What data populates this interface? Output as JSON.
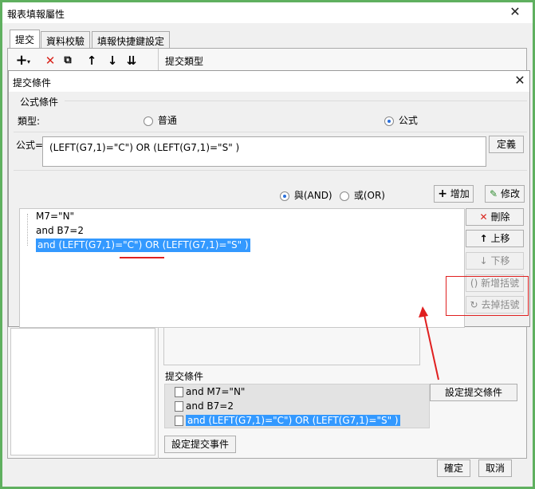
{
  "main_window": {
    "title": "報表填報屬性",
    "close_glyph": "✕",
    "tabs": [
      {
        "label": "提交",
        "active": true
      },
      {
        "label": "資料校驗",
        "active": false
      },
      {
        "label": "填報快捷鍵設定",
        "active": false
      }
    ],
    "section_title": "提交類型",
    "submit_conditions_label": "提交條件",
    "set_submit_conditions_button": "設定提交條件",
    "set_submit_event_button": "設定提交事件",
    "submit_conditions_items": [
      "and M7=\"N\"",
      "and B7=2",
      "and  (LEFT(G7,1)=\"C\") OR (LEFT(G7,1)=\"S\" )"
    ],
    "ok_button": "確定",
    "cancel_button": "取消"
  },
  "dialog": {
    "title": "提交條件",
    "close_glyph": "✕",
    "group_title": "公式條件",
    "type_label": "類型:",
    "type_options": [
      {
        "label": "普通",
        "selected": false
      },
      {
        "label": "公式",
        "selected": true
      }
    ],
    "formula_label": "公式=",
    "formula_value": "(LEFT(G7,1)=\"C\") OR (LEFT(G7,1)=\"S\" )",
    "define_button": "定義",
    "logic_options": [
      {
        "label": "與(AND)",
        "selected": true
      },
      {
        "label": "或(OR)",
        "selected": false
      }
    ],
    "add_button": "增加",
    "modify_button": "修改",
    "condition_items": [
      "M7=\"N\"",
      "and B7=2",
      "and  (LEFT(G7,1)=\"C\") OR (LEFT(G7,1)=\"S\" )"
    ],
    "delete_button": "刪除",
    "move_up_button": "上移",
    "move_down_button": "下移",
    "add_bracket_button": "新增括號",
    "remove_bracket_button": "去掉括號"
  },
  "colors": {
    "selection": "#3399ff",
    "annotation_red": "#e02020",
    "window_border": "#5fb05f"
  }
}
